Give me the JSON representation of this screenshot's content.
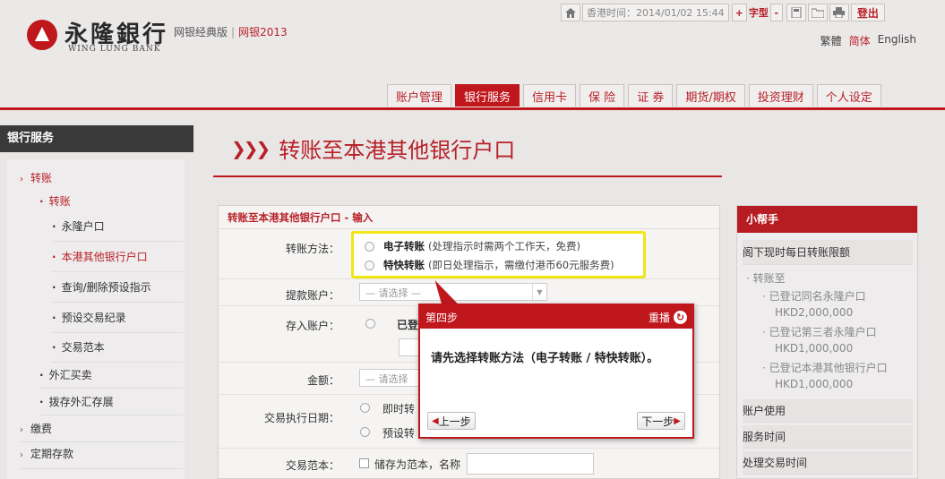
{
  "header": {
    "logo_cn": "永隆銀行",
    "logo_en": "WING LUNG BANK",
    "edition_classic": "网银经典版",
    "edition_sep": "|",
    "edition_new": "网银2013",
    "time_label": "香港时间：2014/01/02 15:44",
    "font_plus": "+",
    "font_label": "字型",
    "font_minus": "-",
    "logout": "登出",
    "lang_trad": "繁體",
    "lang_simp": "简体",
    "lang_eng": "English"
  },
  "nav": {
    "tabs": [
      "账户管理",
      "银行服务",
      "信用卡",
      "保 险",
      "证 券",
      "期货/期权",
      "投资理财",
      "个人设定"
    ],
    "active_index": 1
  },
  "sidebar": {
    "title": "银行服务",
    "transfer": "转账",
    "transfer_sub": "转账",
    "wing_lung": "永隆户口",
    "other_bank": "本港其他银行户口",
    "query_delete": "查询/删除预设指示",
    "preset_records": "预设交易纪录",
    "templates": "交易范本",
    "fx_trading": "外汇买卖",
    "fx_deposit": "拨存外汇存展",
    "pay_bills": "缴费",
    "time_deposit": "定期存款"
  },
  "main": {
    "title": "转账至本港其他银行户口",
    "form_header": "转账至本港其他银行户口 - 输入",
    "labels": {
      "method": "转账方法：",
      "debit": "提款账户：",
      "credit": "存入账户：",
      "amount": "金额：",
      "exec_date": "交易执行日期：",
      "template": "交易范本："
    },
    "debit_placeholder": "— 请选择 —",
    "credit_option": "已登",
    "amount_placeholder": "— 请选择",
    "exec_now": "即时转",
    "exec_preset": "预设转",
    "template_save": "储存为范本，名称",
    "methods": [
      {
        "name": "电子转账",
        "note": "(处理指示时需两个工作天，免费)"
      },
      {
        "name": "特快转账",
        "note": "(即日处理指示，需缴付港币60元服务费)"
      }
    ]
  },
  "popup": {
    "step": "第四步",
    "replay": "重播",
    "message": "请先选择转账方法（电子转账 / 特快转账）。",
    "prev": "上一步",
    "next": "下一步"
  },
  "helper": {
    "title": "小帮手",
    "section_limit": "阁下现时每日转账限额",
    "transfer_to": "转账至",
    "items": [
      {
        "label": "已登记同名永隆户口",
        "amount": "HKD2,000,000"
      },
      {
        "label": "已登记第三者永隆户口",
        "amount": "HKD1,000,000"
      },
      {
        "label": "已登记本港其他银行户口",
        "amount": "HKD1,000,000"
      }
    ],
    "account_usage": "账户使用",
    "service_hours": "服务时间",
    "processing_time": "处理交易时间"
  }
}
